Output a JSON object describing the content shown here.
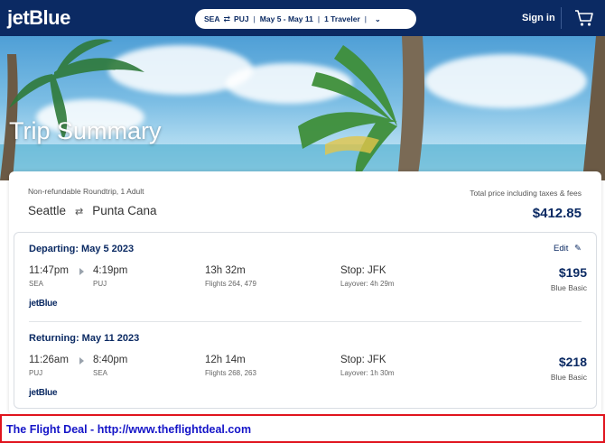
{
  "header": {
    "logo": "jetBlue",
    "search": {
      "origin": "SEA",
      "destination": "PUJ",
      "dates": "May 5 - May 11",
      "travelers": "1 Traveler"
    },
    "signin": "Sign in"
  },
  "hero": {
    "title": "Trip Summary"
  },
  "summary": {
    "trip_type": "Non-refundable Roundtrip, 1 Adult",
    "origin_city": "Seattle",
    "destination_city": "Punta Cana",
    "total_label": "Total price including taxes & fees",
    "total_price": "$412.85"
  },
  "segments": [
    {
      "title": "Departing: May 5 2023",
      "edit": "Edit",
      "depart_time": "11:47pm",
      "depart_code": "SEA",
      "arrive_time": "4:19pm",
      "arrive_code": "PUJ",
      "duration": "13h 32m",
      "flights": "Flights 264, 479",
      "stop": "Stop: JFK",
      "layover": "Layover: 4h 29m",
      "price": "$195",
      "fare": "Blue Basic",
      "airline": "jetBlue"
    },
    {
      "title": "Returning: May 11 2023",
      "depart_time": "11:26am",
      "depart_code": "PUJ",
      "arrive_time": "8:40pm",
      "arrive_code": "SEA",
      "duration": "12h 14m",
      "flights": "Flights 268, 263",
      "stop": "Stop: JFK",
      "layover": "Layover: 1h 30m",
      "price": "$218",
      "fare": "Blue Basic",
      "airline": "jetBlue"
    }
  ],
  "footer": {
    "text": "The Flight Deal - http://www.theflightdeal.com"
  },
  "colors": {
    "navy": "#0b2a63",
    "deal_border": "#e0141e",
    "deal_text": "#1515c8"
  }
}
